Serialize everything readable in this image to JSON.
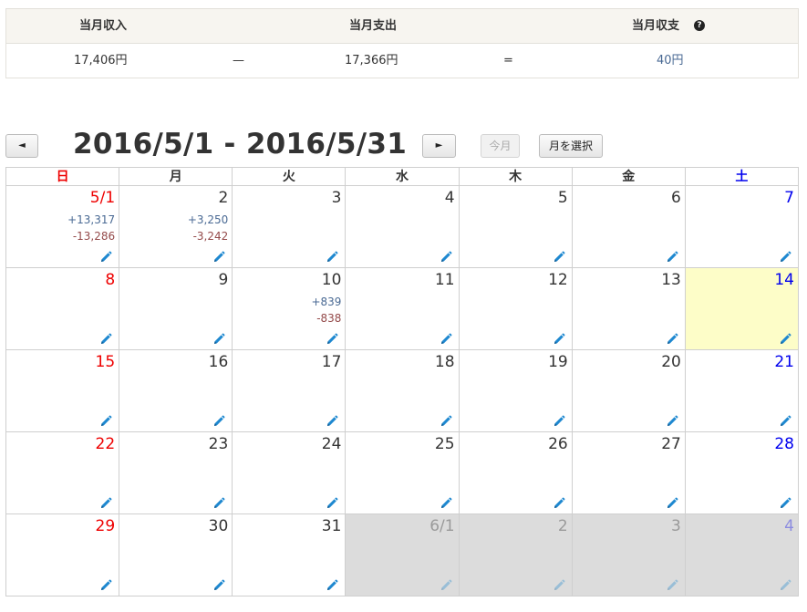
{
  "summary": {
    "headers": {
      "income": "当月収入",
      "expense": "当月支出",
      "balance": "当月収支"
    },
    "help_icon": "?",
    "values": {
      "income": "17,406円",
      "minus": "—",
      "expense": "17,366円",
      "equals": "=",
      "balance": "40円"
    }
  },
  "nav": {
    "prev": "◄",
    "title": "2016/5/1 - 2016/5/31",
    "next": "►",
    "this_month": "今月",
    "select_month": "月を選択"
  },
  "weekdays": [
    "日",
    "月",
    "火",
    "水",
    "木",
    "金",
    "土"
  ],
  "weeks": [
    [
      {
        "label": "5/1",
        "income": "+13,317",
        "expense": "-13,286"
      },
      {
        "label": "2",
        "income": "+3,250",
        "expense": "-3,242"
      },
      {
        "label": "3"
      },
      {
        "label": "4"
      },
      {
        "label": "5"
      },
      {
        "label": "6"
      },
      {
        "label": "7"
      }
    ],
    [
      {
        "label": "8"
      },
      {
        "label": "9"
      },
      {
        "label": "10",
        "income": "+839",
        "expense": "-838"
      },
      {
        "label": "11"
      },
      {
        "label": "12"
      },
      {
        "label": "13"
      },
      {
        "label": "14",
        "today": true
      }
    ],
    [
      {
        "label": "15"
      },
      {
        "label": "16"
      },
      {
        "label": "17"
      },
      {
        "label": "18"
      },
      {
        "label": "19"
      },
      {
        "label": "20"
      },
      {
        "label": "21"
      }
    ],
    [
      {
        "label": "22"
      },
      {
        "label": "23"
      },
      {
        "label": "24"
      },
      {
        "label": "25"
      },
      {
        "label": "26"
      },
      {
        "label": "27"
      },
      {
        "label": "28"
      }
    ],
    [
      {
        "label": "29"
      },
      {
        "label": "30"
      },
      {
        "label": "31"
      },
      {
        "label": "6/1",
        "other": true
      },
      {
        "label": "2",
        "other": true
      },
      {
        "label": "3",
        "other": true
      },
      {
        "label": "4",
        "other": true
      }
    ]
  ],
  "icons": {
    "edit": "pencil-icon"
  },
  "colors": {
    "sunday": "#e00000",
    "saturday": "#0000e0",
    "income": "#4a6a94",
    "expense": "#944a4a",
    "today": "#fdfdc8",
    "other_month": "#dcdcdc",
    "pencil": "#1e88d0"
  }
}
